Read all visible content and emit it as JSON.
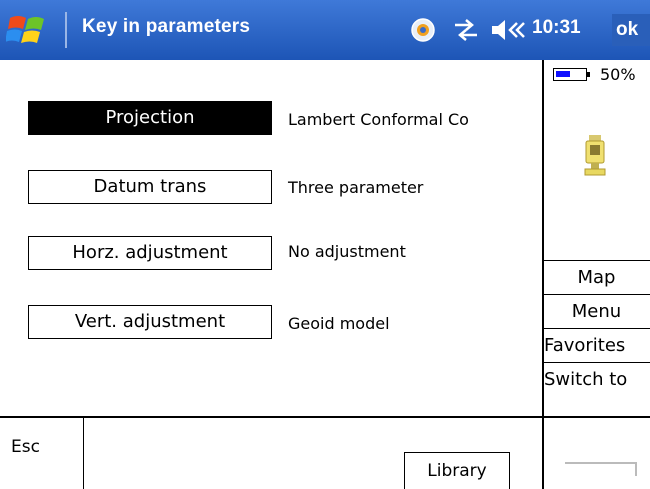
{
  "titlebar": {
    "title": "Key in parameters",
    "time": "10:31",
    "ok_label": "ok",
    "icons": [
      "windows-start-icon",
      "connectivity-icon",
      "data-sync-icon",
      "volume-icon"
    ]
  },
  "parameters": [
    {
      "label": "Projection",
      "value": "Lambert Conformal Co",
      "selected": true
    },
    {
      "label": "Datum trans",
      "value": "Three parameter",
      "selected": false
    },
    {
      "label": "Horz. adjustment",
      "value": "No adjustment",
      "selected": false
    },
    {
      "label": "Vert. adjustment",
      "value": "Geoid model",
      "selected": false
    }
  ],
  "status": {
    "battery_percent": "50%",
    "battery_level": 0.5,
    "instrument_icon": "total-station-icon"
  },
  "side_menu": {
    "map": "Map",
    "menu": "Menu",
    "favorites": "Favorites",
    "switch_to": "Switch to"
  },
  "bottom": {
    "esc": "Esc",
    "library": "Library"
  },
  "colors": {
    "titlebar": "#2a5fb9",
    "selected_bg": "#000000",
    "battery_fill": "#1010ff"
  }
}
